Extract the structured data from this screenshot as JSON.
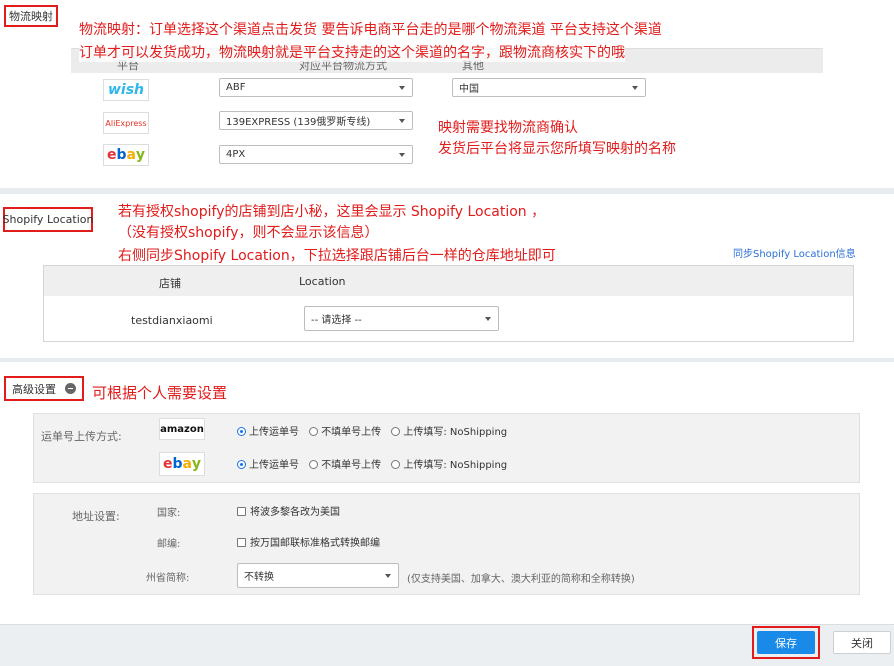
{
  "logistics": {
    "section_label": "物流映射",
    "note_line1": "物流映射：订单选择这个渠道点击发货  要告诉电商平台走的是哪个物流渠道   平台支持这个渠道",
    "note_line2": "订单才可以发货成功，物流映射就是平台支持走的这个渠道的名字，跟物流商核实下的哦",
    "header": [
      "平台",
      "对应平台物流方式",
      "其他"
    ],
    "rows": [
      {
        "platform": "wish",
        "method": "ABF",
        "other": "中国"
      },
      {
        "platform": "AliExpress",
        "method": "139EXPRESS (139俄罗斯专线)",
        "other": ""
      },
      {
        "platform": "ebay",
        "method": "4PX",
        "other": ""
      }
    ],
    "mapping_note_line1": "映射需要找物流商确认",
    "mapping_note_line2": "发货后平台将显示您所填写映射的名称"
  },
  "shopify": {
    "section_label": "Shopify Location",
    "note_line1": "若有授权shopify的店铺到店小秘，这里会显示 Shopify Location ，",
    "note_line2": "（没有授权shopify，则不会显示该信息）",
    "note_line3": "右侧同步Shopify Location，下拉选择跟店铺后台一样的仓库地址即可",
    "sync_link": "同步Shopify Location信息",
    "col_store": "店铺",
    "col_location": "Location",
    "store_name": "testdianxiaomi",
    "location_select": "-- 请选择 --"
  },
  "advanced": {
    "section_label": "高级设置",
    "note": "可根据个人需要设置",
    "upload_label": "运单号上传方式:",
    "upload_rows": [
      {
        "platform": "amazon",
        "opt1": "上传运单号",
        "opt2": "不填单号上传",
        "opt3": "上传填写: NoShipping"
      },
      {
        "platform": "ebay",
        "opt1": "上传运单号",
        "opt2": "不填单号上传",
        "opt3": "上传填写: NoShipping"
      }
    ],
    "address_label": "地址设置:",
    "country_label": "国家:",
    "country_option": "将波多黎各改为美国",
    "zip_label": "邮编:",
    "zip_option": "按万国邮联标准格式转换邮编",
    "state_label": "州省简称:",
    "state_select": "不转换",
    "state_hint": "(仅支持美国、加拿大、澳大利亚的简称和全称转换)"
  },
  "footer": {
    "save": "保存",
    "close": "关闭"
  },
  "colors": {
    "annotation_red": "#e21b1b",
    "primary_blue": "#1a8ae8",
    "link_blue": "#2a6fd6"
  }
}
